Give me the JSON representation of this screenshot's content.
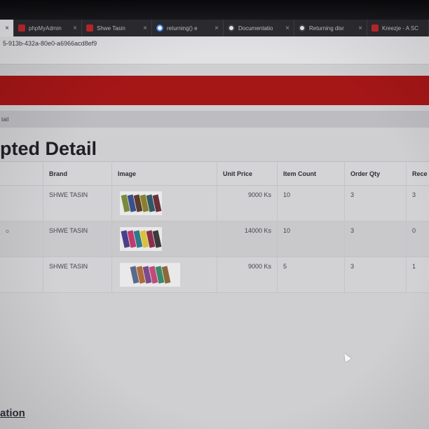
{
  "browser": {
    "tabs": [
      {
        "label": "",
        "active": true
      },
      {
        "label": "phpMyAdmin",
        "active": false
      },
      {
        "label": "Shwe Tasin",
        "active": false
      },
      {
        "label": "returning() e",
        "active": false
      },
      {
        "label": "Documentatio",
        "active": false
      },
      {
        "label": "Returning disr",
        "active": false
      },
      {
        "label": "Kreezje - A SC",
        "active": false
      }
    ],
    "tab_close_glyph": "×",
    "url_fragment": "5-913b-432a-80e0-a6966acd8ef9"
  },
  "breadcrumb": {
    "text": "tail"
  },
  "page": {
    "title": "pted Detail",
    "section_title": "ation"
  },
  "table": {
    "columns": [
      "",
      "Brand",
      "Image",
      "Unit Price",
      "Item Count",
      "Order Qty",
      "Rece"
    ],
    "rows": [
      {
        "c0": "",
        "brand": "SHWE TASIN",
        "image": "product-image-1",
        "unit_price": "9000 Ks",
        "item_count": "10",
        "order_qty": "3",
        "received": "3"
      },
      {
        "c0": "ဝ",
        "brand": "SHWE TASIN",
        "image": "product-image-2",
        "unit_price": "14000 Ks",
        "item_count": "10",
        "order_qty": "3",
        "received": "0"
      },
      {
        "c0": "",
        "brand": "SHWE TASIN",
        "image": "product-image-3",
        "unit_price": "9000 Ks",
        "item_count": "5",
        "order_qty": "3",
        "received": "1"
      }
    ]
  },
  "colors": {
    "brand_red": "#a51617",
    "thumb_swatches": [
      [
        "#7a8a3c",
        "#3b4f8e",
        "#5a3d2b",
        "#8a7f2f",
        "#2f5a63",
        "#6b2f3a"
      ],
      [
        "#4a3f8a",
        "#c23a6a",
        "#2f7a8a",
        "#d8c23a",
        "#8a2f4a",
        "#3a3a3a"
      ],
      [
        "#5a6a8a",
        "#b06a3a",
        "#7a4a8a",
        "#c24a7a",
        "#3a8a6a",
        "#8a6a3a"
      ]
    ]
  }
}
